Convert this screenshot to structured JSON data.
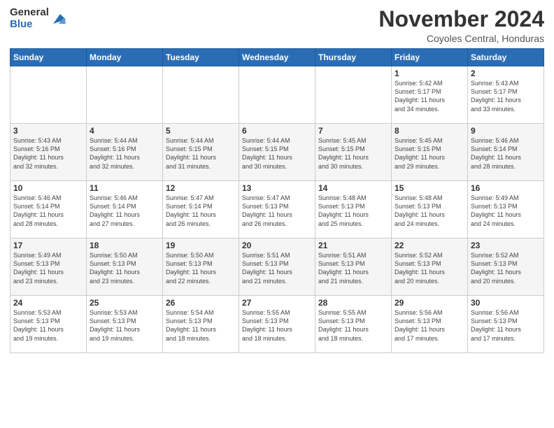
{
  "logo": {
    "general": "General",
    "blue": "Blue"
  },
  "title": {
    "month_year": "November 2024",
    "location": "Coyoles Central, Honduras"
  },
  "headers": [
    "Sunday",
    "Monday",
    "Tuesday",
    "Wednesday",
    "Thursday",
    "Friday",
    "Saturday"
  ],
  "weeks": [
    [
      {
        "day": "",
        "info": ""
      },
      {
        "day": "",
        "info": ""
      },
      {
        "day": "",
        "info": ""
      },
      {
        "day": "",
        "info": ""
      },
      {
        "day": "",
        "info": ""
      },
      {
        "day": "1",
        "info": "Sunrise: 5:42 AM\nSunset: 5:17 PM\nDaylight: 11 hours\nand 34 minutes."
      },
      {
        "day": "2",
        "info": "Sunrise: 5:43 AM\nSunset: 5:17 PM\nDaylight: 11 hours\nand 33 minutes."
      }
    ],
    [
      {
        "day": "3",
        "info": "Sunrise: 5:43 AM\nSunset: 5:16 PM\nDaylight: 11 hours\nand 32 minutes."
      },
      {
        "day": "4",
        "info": "Sunrise: 5:44 AM\nSunset: 5:16 PM\nDaylight: 11 hours\nand 32 minutes."
      },
      {
        "day": "5",
        "info": "Sunrise: 5:44 AM\nSunset: 5:15 PM\nDaylight: 11 hours\nand 31 minutes."
      },
      {
        "day": "6",
        "info": "Sunrise: 5:44 AM\nSunset: 5:15 PM\nDaylight: 11 hours\nand 30 minutes."
      },
      {
        "day": "7",
        "info": "Sunrise: 5:45 AM\nSunset: 5:15 PM\nDaylight: 11 hours\nand 30 minutes."
      },
      {
        "day": "8",
        "info": "Sunrise: 5:45 AM\nSunset: 5:15 PM\nDaylight: 11 hours\nand 29 minutes."
      },
      {
        "day": "9",
        "info": "Sunrise: 5:46 AM\nSunset: 5:14 PM\nDaylight: 11 hours\nand 28 minutes."
      }
    ],
    [
      {
        "day": "10",
        "info": "Sunrise: 5:46 AM\nSunset: 5:14 PM\nDaylight: 11 hours\nand 28 minutes."
      },
      {
        "day": "11",
        "info": "Sunrise: 5:46 AM\nSunset: 5:14 PM\nDaylight: 11 hours\nand 27 minutes."
      },
      {
        "day": "12",
        "info": "Sunrise: 5:47 AM\nSunset: 5:14 PM\nDaylight: 11 hours\nand 26 minutes."
      },
      {
        "day": "13",
        "info": "Sunrise: 5:47 AM\nSunset: 5:13 PM\nDaylight: 11 hours\nand 26 minutes."
      },
      {
        "day": "14",
        "info": "Sunrise: 5:48 AM\nSunset: 5:13 PM\nDaylight: 11 hours\nand 25 minutes."
      },
      {
        "day": "15",
        "info": "Sunrise: 5:48 AM\nSunset: 5:13 PM\nDaylight: 11 hours\nand 24 minutes."
      },
      {
        "day": "16",
        "info": "Sunrise: 5:49 AM\nSunset: 5:13 PM\nDaylight: 11 hours\nand 24 minutes."
      }
    ],
    [
      {
        "day": "17",
        "info": "Sunrise: 5:49 AM\nSunset: 5:13 PM\nDaylight: 11 hours\nand 23 minutes."
      },
      {
        "day": "18",
        "info": "Sunrise: 5:50 AM\nSunset: 5:13 PM\nDaylight: 11 hours\nand 23 minutes."
      },
      {
        "day": "19",
        "info": "Sunrise: 5:50 AM\nSunset: 5:13 PM\nDaylight: 11 hours\nand 22 minutes."
      },
      {
        "day": "20",
        "info": "Sunrise: 5:51 AM\nSunset: 5:13 PM\nDaylight: 11 hours\nand 21 minutes."
      },
      {
        "day": "21",
        "info": "Sunrise: 5:51 AM\nSunset: 5:13 PM\nDaylight: 11 hours\nand 21 minutes."
      },
      {
        "day": "22",
        "info": "Sunrise: 5:52 AM\nSunset: 5:13 PM\nDaylight: 11 hours\nand 20 minutes."
      },
      {
        "day": "23",
        "info": "Sunrise: 5:52 AM\nSunset: 5:13 PM\nDaylight: 11 hours\nand 20 minutes."
      }
    ],
    [
      {
        "day": "24",
        "info": "Sunrise: 5:53 AM\nSunset: 5:13 PM\nDaylight: 11 hours\nand 19 minutes."
      },
      {
        "day": "25",
        "info": "Sunrise: 5:53 AM\nSunset: 5:13 PM\nDaylight: 11 hours\nand 19 minutes."
      },
      {
        "day": "26",
        "info": "Sunrise: 5:54 AM\nSunset: 5:13 PM\nDaylight: 11 hours\nand 18 minutes."
      },
      {
        "day": "27",
        "info": "Sunrise: 5:55 AM\nSunset: 5:13 PM\nDaylight: 11 hours\nand 18 minutes."
      },
      {
        "day": "28",
        "info": "Sunrise: 5:55 AM\nSunset: 5:13 PM\nDaylight: 11 hours\nand 18 minutes."
      },
      {
        "day": "29",
        "info": "Sunrise: 5:56 AM\nSunset: 5:13 PM\nDaylight: 11 hours\nand 17 minutes."
      },
      {
        "day": "30",
        "info": "Sunrise: 5:56 AM\nSunset: 5:13 PM\nDaylight: 11 hours\nand 17 minutes."
      }
    ]
  ]
}
